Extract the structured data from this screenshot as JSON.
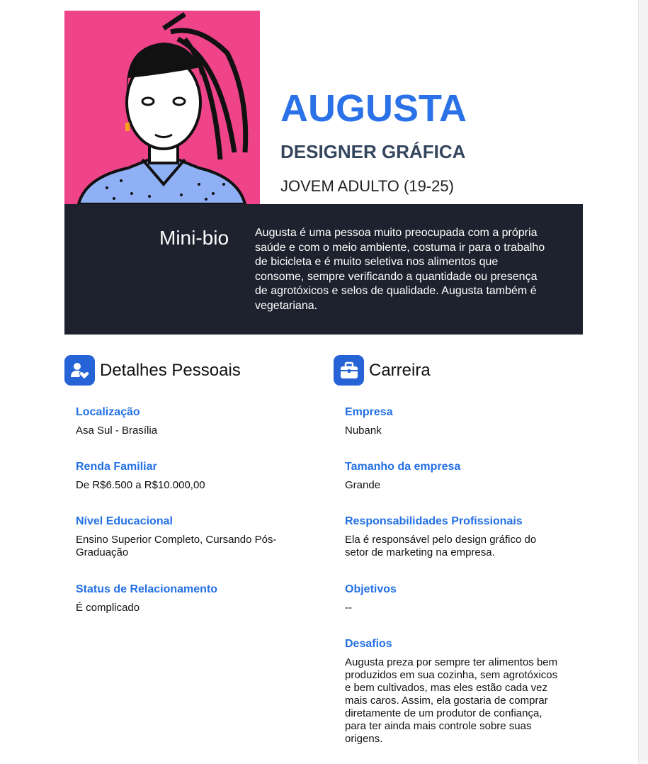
{
  "header": {
    "name": "AUGUSTA",
    "role": "DESIGNER GRÁFICA",
    "age_group": "JOVEM ADULTO (19-25)"
  },
  "bio": {
    "label": "Mini-bio",
    "text": "Augusta é uma pessoa muito preocupada com a própria saúde e com o meio ambiente, costuma ir para o trabalho de bicicleta e é muito seletiva nos alimentos que consome, sempre verificando a quantidade ou presença de agrotóxicos e selos de qualidade. Augusta também é vegetariana."
  },
  "personal": {
    "title": "Detalhes Pessoais",
    "icon": "user-heart-icon",
    "fields": [
      {
        "label": "Localização",
        "value": "Asa Sul - Brasília"
      },
      {
        "label": "Renda Familiar",
        "value": "De R$6.500 a R$10.000,00"
      },
      {
        "label": "Nível Educacional",
        "value": "Ensino Superior Completo, Cursando Pós-Graduação"
      },
      {
        "label": "Status de Relacionamento",
        "value": "É complicado"
      }
    ]
  },
  "career": {
    "title": "Carreira",
    "icon": "briefcase-icon",
    "fields": [
      {
        "label": "Empresa",
        "value": "Nubank"
      },
      {
        "label": "Tamanho da empresa",
        "value": "Grande"
      },
      {
        "label": "Responsabilidades Profissionais",
        "value": "Ela é responsável pelo design gráfico do setor de marketing na empresa."
      },
      {
        "label": "Objetivos",
        "value": "--"
      },
      {
        "label": "Desafios",
        "value": "Augusta preza por sempre ter alimentos bem produzidos em sua cozinha, sem agrotóxicos e bem cultivados, mas eles estão cada vez mais caros. Assim, ela gostaria de comprar diretamente de um produtor de confiança, para ter ainda mais controle sobre suas origens."
      }
    ]
  },
  "colors": {
    "accent": "#2b72e8",
    "pink": "#f0448a",
    "dark": "#1d222e"
  }
}
